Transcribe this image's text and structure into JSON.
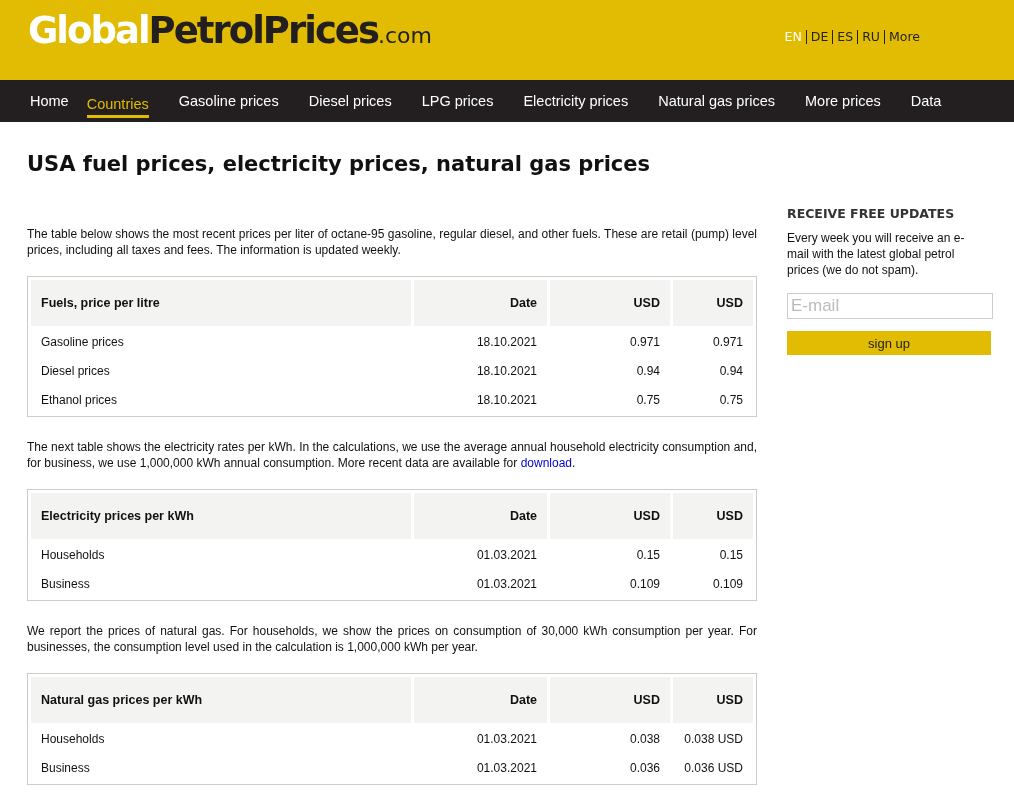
{
  "header": {
    "logo": {
      "part_1": "Global",
      "part_2": "PetrolPrices",
      "part_3": ".com"
    },
    "languages": [
      {
        "label": "EN",
        "selected": true
      },
      {
        "label": "DE",
        "selected": false
      },
      {
        "label": "ES",
        "selected": false
      },
      {
        "label": "RU",
        "selected": false
      },
      {
        "label": "More",
        "selected": false
      }
    ]
  },
  "nav": [
    {
      "label": "Home",
      "selected": false
    },
    {
      "label": "Countries",
      "selected": true
    },
    {
      "label": "Gasoline prices",
      "selected": false
    },
    {
      "label": "Diesel prices",
      "selected": false
    },
    {
      "label": "LPG prices",
      "selected": false
    },
    {
      "label": "Electricity prices",
      "selected": false
    },
    {
      "label": "Natural gas prices",
      "selected": false
    },
    {
      "label": "More prices",
      "selected": false
    },
    {
      "label": "Data",
      "selected": false
    }
  ],
  "main": {
    "title": "USA fuel prices, electricity prices, natural gas prices",
    "sections": [
      {
        "intro": [
          {
            "kind": "text",
            "text": "The table below shows the most recent prices per liter of octane-95 gasoline, regular diesel, and other fuels. These are retail (pump) level prices, including all taxes and fees. The information is updated weekly."
          }
        ],
        "table": {
          "columns": [
            "Fuels, price per litre",
            "Date",
            "USD",
            "USD"
          ],
          "rows": [
            [
              "Gasoline prices",
              "18.10.2021",
              "0.971",
              "0.971"
            ],
            [
              "Diesel prices",
              "18.10.2021",
              "0.94",
              "0.94"
            ],
            [
              "Ethanol prices",
              "18.10.2021",
              "0.75",
              "0.75"
            ]
          ]
        }
      },
      {
        "intro": [
          {
            "kind": "text",
            "text": "The next table shows the electricity rates per kWh. In the calculations, we use the average annual household electricity consumption and, for business, we use 1,000,000 kWh annual consumption. More recent data are available for "
          },
          {
            "kind": "link",
            "text": "download"
          },
          {
            "kind": "text",
            "text": "."
          }
        ],
        "table": {
          "columns": [
            "Electricity prices per kWh",
            "Date",
            "USD",
            "USD"
          ],
          "rows": [
            [
              "Households",
              "01.03.2021",
              "0.15",
              "0.15"
            ],
            [
              "Business",
              "01.03.2021",
              "0.109",
              "0.109"
            ]
          ]
        }
      },
      {
        "intro": [
          {
            "kind": "text",
            "text": "We report the prices of natural gas. For households, we show the prices on consumption of 30,000 kWh consumption per year. For businesses, the consumption level used in the calculation is 1,000,000 kWh per year."
          }
        ],
        "table": {
          "columns": [
            "Natural gas prices per kWh",
            "Date",
            "USD",
            "USD"
          ],
          "rows": [
            [
              "Households",
              "01.03.2021",
              "0.038",
              "0.038 USD"
            ],
            [
              "Business",
              "01.03.2021",
              "0.036",
              "0.036 USD"
            ]
          ]
        }
      }
    ]
  },
  "sidebar": {
    "heading": "RECEIVE FREE UPDATES",
    "text": "Every week you will receive an e-mail with the latest global petrol prices (we do not spam).",
    "email": {
      "placeholder": "E-mail"
    },
    "button": "sign up"
  }
}
